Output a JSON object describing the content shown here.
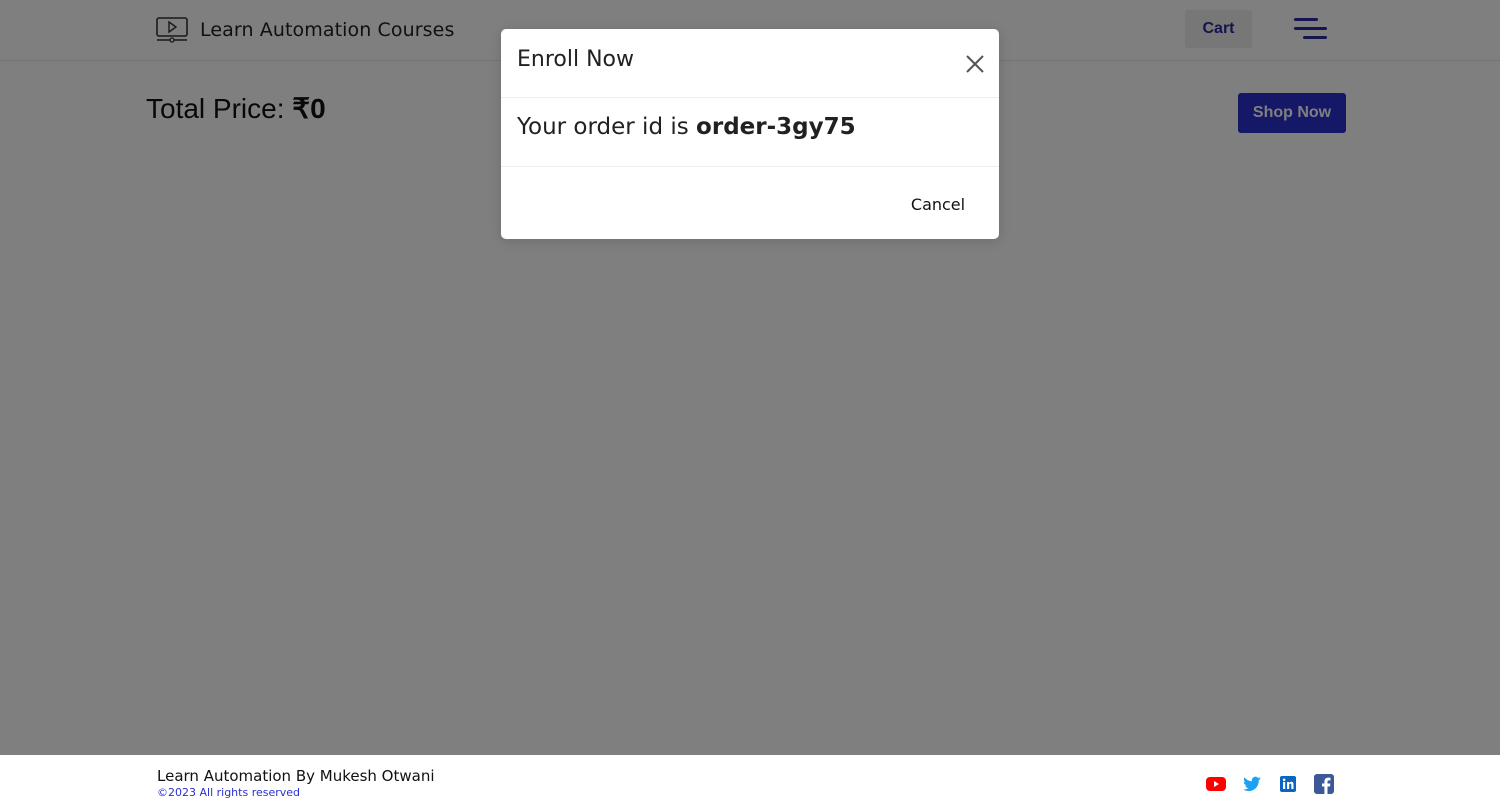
{
  "navbar": {
    "brand_icon": "video-player-icon",
    "brand_text": "Learn Automation Courses",
    "cart_label": "Cart",
    "menu_icon": "hamburger-menu-icon"
  },
  "page": {
    "total_price_label": "Total Price:",
    "total_price_value": "₹0",
    "shop_now_label": "Shop Now"
  },
  "modal": {
    "title": "Enroll Now",
    "close_icon": "close-icon",
    "order_text_prefix": "Your order id is",
    "order_id": "order-3gy75",
    "cancel_label": "Cancel"
  },
  "footer": {
    "title": "Learn Automation By Mukesh Otwani",
    "copyright": "©2023 All rights reserved",
    "social": [
      {
        "icon": "youtube-icon",
        "color": "#ff0000"
      },
      {
        "icon": "twitter-icon",
        "color": "#1da1f2"
      },
      {
        "icon": "linkedin-icon",
        "color": "#0a66c2"
      },
      {
        "icon": "facebook-icon",
        "color": "#3b5998"
      }
    ]
  },
  "colors": {
    "accent": "#2a2fcf",
    "backdrop": "rgba(0,0,0,0.5)"
  }
}
